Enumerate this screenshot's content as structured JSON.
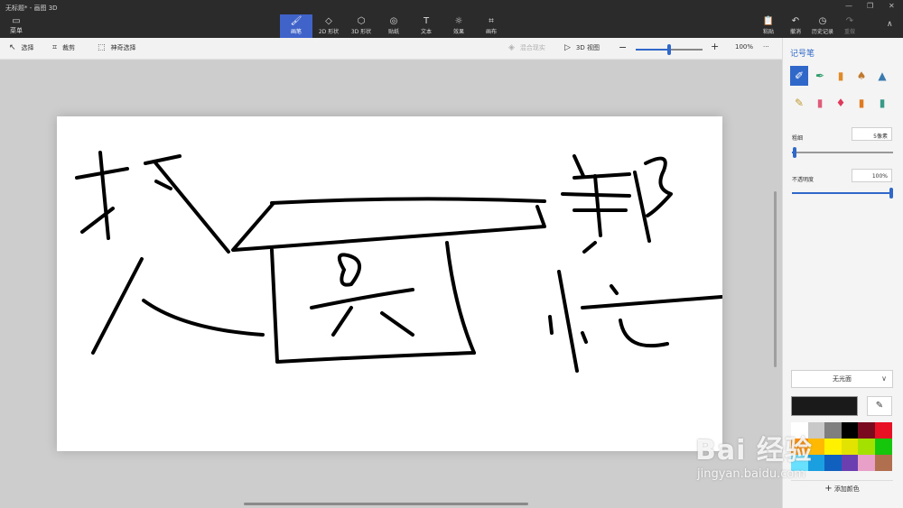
{
  "app": {
    "title": "无标题* - 画图 3D"
  },
  "ribbon": {
    "menu_label": "菜单",
    "tools": [
      {
        "id": "brushes",
        "label": "画笔",
        "icon": "brush-icon",
        "glyph": "🖌",
        "active": true
      },
      {
        "id": "2d-shapes",
        "label": "2D 形状",
        "icon": "2d-shapes-icon",
        "glyph": "◇",
        "active": false
      },
      {
        "id": "3d-shapes",
        "label": "3D 形状",
        "icon": "3d-cube-icon",
        "glyph": "⬡",
        "active": false
      },
      {
        "id": "stickers",
        "label": "贴纸",
        "icon": "sticker-icon",
        "glyph": "◎",
        "active": false
      },
      {
        "id": "text",
        "label": "文本",
        "icon": "text-icon",
        "glyph": "T",
        "active": false
      },
      {
        "id": "effects",
        "label": "效果",
        "icon": "effects-icon",
        "glyph": "☼",
        "active": false
      },
      {
        "id": "canvas",
        "label": "画布",
        "icon": "canvas-icon",
        "glyph": "⌗",
        "active": false
      }
    ],
    "right_tools": [
      {
        "id": "paste",
        "label": "粘贴",
        "icon": "paste-icon",
        "glyph": "📋",
        "dim": false
      },
      {
        "id": "undo",
        "label": "撤消",
        "icon": "undo-icon",
        "glyph": "↶",
        "dim": false
      },
      {
        "id": "history",
        "label": "历史记录",
        "icon": "history-icon",
        "glyph": "◷",
        "dim": false
      },
      {
        "id": "redo",
        "label": "重做",
        "icon": "redo-icon",
        "glyph": "↷",
        "dim": true
      }
    ]
  },
  "toolbar": {
    "select_label": "选择",
    "crop_label": "裁剪",
    "magic_select_label": "神奇选择",
    "mixed_reality_label": "混合现实",
    "view_3d_label": "3D 视图",
    "zoom_minus": "−",
    "zoom_plus": "+",
    "zoom_value": "100%",
    "zoom_fraction": 0.5,
    "more": "···"
  },
  "panel": {
    "title": "记号笔",
    "brushes": [
      {
        "name": "marker-brush",
        "glyph": "✐",
        "color": "#ffffff",
        "selected": true
      },
      {
        "name": "calligraphy-pen-brush",
        "glyph": "✒",
        "color": "#2a9a6a",
        "selected": false
      },
      {
        "name": "oil-brush",
        "glyph": "▮",
        "color": "#e08a2a",
        "selected": false
      },
      {
        "name": "watercolor-brush",
        "glyph": "♠",
        "color": "#c07a30",
        "selected": false
      },
      {
        "name": "pixel-pen-brush",
        "glyph": "▲",
        "color": "#3a7ab0",
        "selected": false
      },
      {
        "name": "pencil-brush",
        "glyph": "✎",
        "color": "#c09a30",
        "selected": false
      },
      {
        "name": "eraser-brush",
        "glyph": "▮",
        "color": "#e05a7a",
        "selected": false
      },
      {
        "name": "crayon-brush",
        "glyph": "♦",
        "color": "#e03a5a",
        "selected": false
      },
      {
        "name": "spray-can-brush",
        "glyph": "▮",
        "color": "#e07a20",
        "selected": false
      },
      {
        "name": "fill-brush",
        "glyph": "▮",
        "color": "#3a9a8a",
        "selected": false
      }
    ],
    "thickness_label": "粗细",
    "thickness_value": "5像素",
    "thickness_fraction": 0.03,
    "opacity_label": "不透明度",
    "opacity_value": "100%",
    "opacity_fraction": 1.0,
    "finish_value": "无光面",
    "current_color": "#1a1a1a",
    "add_color_label": "添加颜色",
    "palette": [
      "#ffffff",
      "#c8c8c8",
      "#7f7f7f",
      "#000000",
      "#7a0b1e",
      "#e81123",
      "#ff8c00",
      "#ffb900",
      "#fff100",
      "#e3e300",
      "#a4e000",
      "#16c60c",
      "#68e0ff",
      "#1a9fe0",
      "#1060c0",
      "#6b3fb0",
      "#e8a0c8",
      "#b07050"
    ]
  },
  "watermark": {
    "main": "Bai 经验",
    "sub": "jingyan.baidu.com"
  }
}
